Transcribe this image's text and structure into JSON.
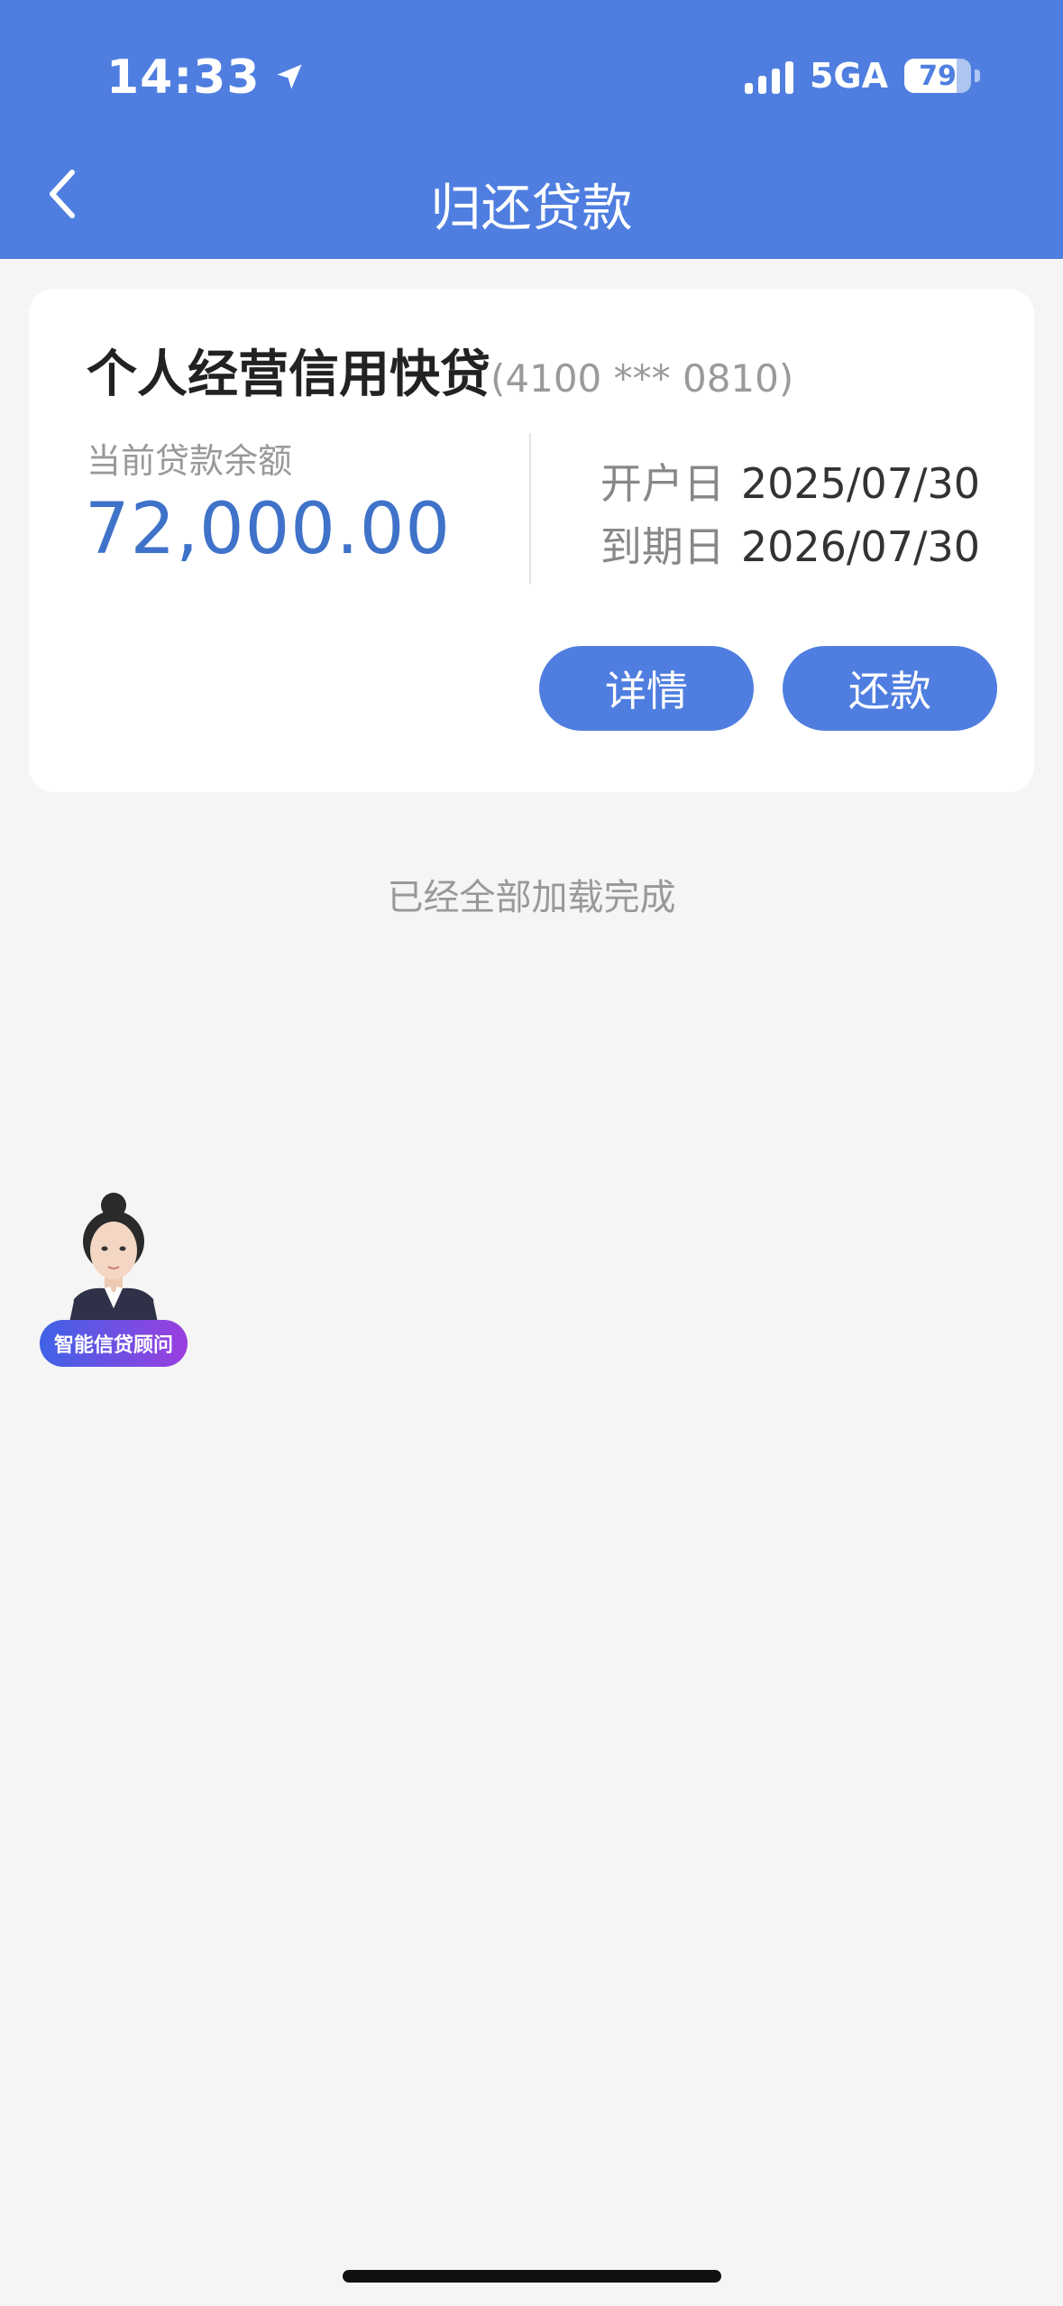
{
  "status_bar": {
    "time": "14:33",
    "network": "5GA",
    "battery": "79",
    "battery_level": 0.79
  },
  "header": {
    "title": "归还贷款"
  },
  "loan": {
    "name": "个人经营信用快贷",
    "account": "(4100 *** 0810)",
    "balance_label": "当前贷款余额",
    "balance": "72,000.00",
    "open_label": "开户日",
    "open_date": "2025/07/30",
    "due_label": "到期日",
    "due_date": "2026/07/30",
    "detail_button": "详情",
    "repay_button": "还款"
  },
  "list_footer": "已经全部加载完成",
  "advisor": {
    "label": "智能信贷顾问"
  },
  "colors": {
    "brand": "#4f7ee0",
    "amount": "#3f72c9",
    "background": "#f5f5f5"
  },
  "icons": [
    "location-arrow-icon",
    "signal-icon",
    "battery-icon",
    "back-chevron-icon"
  ]
}
